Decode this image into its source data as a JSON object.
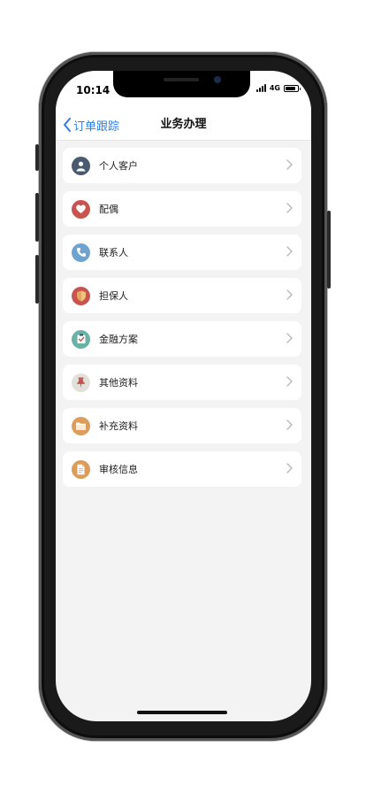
{
  "status_bar": {
    "time": "10:14",
    "network": "4G"
  },
  "nav": {
    "back_label": "订单跟踪",
    "title": "业务办理"
  },
  "menu": {
    "items": [
      {
        "label": "个人客户",
        "icon": "person-icon",
        "color": "#4a5b70"
      },
      {
        "label": "配偶",
        "icon": "heart-icon",
        "color": "#c9534f"
      },
      {
        "label": "联系人",
        "icon": "phone-icon",
        "color": "#6fa3cf"
      },
      {
        "label": "担保人",
        "icon": "shield-icon",
        "color": "#c9534f"
      },
      {
        "label": "金融方案",
        "icon": "checklist-icon",
        "color": "#69b2a4"
      },
      {
        "label": "其他资料",
        "icon": "pushpin-icon",
        "color": "#e3e0da"
      },
      {
        "label": "补充资料",
        "icon": "folder-icon",
        "color": "#dc9c5a"
      },
      {
        "label": "审核信息",
        "icon": "document-icon",
        "color": "#dc9c5a"
      }
    ]
  },
  "colors": {
    "accent": "#2f7de1",
    "background": "#f3f3f3"
  }
}
